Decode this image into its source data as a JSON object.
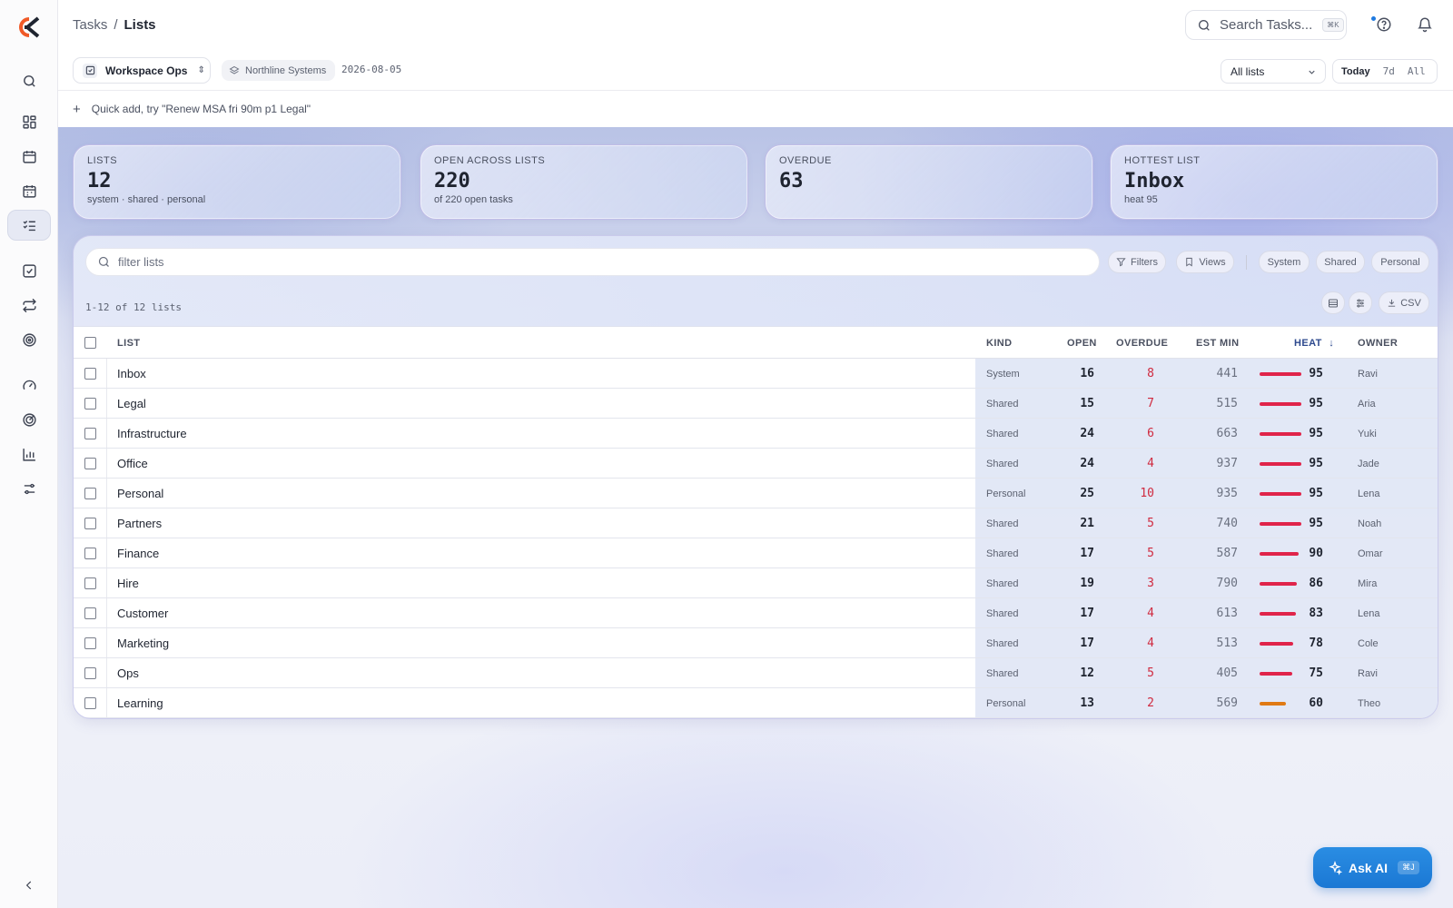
{
  "colors": {
    "accent": "#1b78d4",
    "logo_orange": "#f05a28",
    "logo_dark": "#1f2430",
    "overdue_red": "#d02a3f",
    "heat_high": "#e0244a",
    "heat_mid": "#e07a14"
  },
  "sidebar": {
    "logo": "brand-logo",
    "items": [
      {
        "icon": "search-icon"
      },
      {
        "icon": "dashboard-icon"
      },
      {
        "icon": "calendar-icon"
      },
      {
        "icon": "calendar-grid-icon"
      },
      {
        "icon": "list-checks-icon",
        "active": true
      },
      {
        "icon": "checkbox-icon"
      },
      {
        "icon": "repeat-icon"
      },
      {
        "icon": "target-icon"
      },
      {
        "icon": "gauge-icon"
      },
      {
        "icon": "radar-icon"
      },
      {
        "icon": "bar-chart-icon"
      },
      {
        "icon": "sliders-icon"
      }
    ],
    "collapse_icon": "chevron-left-icon"
  },
  "header": {
    "breadcrumb": {
      "parent": "Tasks",
      "separator": "/",
      "current": "Lists"
    },
    "search": {
      "placeholder": "Search Tasks...",
      "shortcut": "⌘K"
    },
    "help_icon": "help-circle-icon",
    "notifications_icon": "bell-icon"
  },
  "context": {
    "workspace": "Workspace Ops",
    "org": "Northline Systems",
    "date": "2026-08-05",
    "list_filter": "All lists",
    "ranges": [
      "Today",
      "7d",
      "All"
    ],
    "selected_range": "Today"
  },
  "quickadd": {
    "placeholder": "Quick add, try \"Renew MSA fri 90m p1 Legal\""
  },
  "stats": [
    {
      "label": "LISTS",
      "value": "12",
      "sub": "system · shared · personal"
    },
    {
      "label": "OPEN ACROSS LISTS",
      "value": "220",
      "sub": "of 220 open tasks"
    },
    {
      "label": "OVERDUE",
      "value": "63",
      "sub": ""
    },
    {
      "label": "HOTTEST LIST",
      "value": "Inbox",
      "sub": "heat 95"
    }
  ],
  "toolbar": {
    "filter_placeholder": "filter lists",
    "filters_label": "Filters",
    "views_label": "Views",
    "kind_pills": [
      "System",
      "Shared",
      "Personal"
    ],
    "count_text": "1-12 of 12 lists",
    "csv_label": "CSV"
  },
  "table": {
    "columns": {
      "list": "LIST",
      "kind": "KIND",
      "open": "OPEN",
      "overdue": "OVERDUE",
      "est": "EST MIN",
      "heat": "HEAT",
      "owner": "OWNER"
    },
    "sort_indicator": "↓",
    "rows": [
      {
        "name": "Inbox",
        "kind": "System",
        "open": "16",
        "overdue": "8",
        "est": "441",
        "heat": "95",
        "heat_value": 95,
        "owner": "Ravi"
      },
      {
        "name": "Legal",
        "kind": "Shared",
        "open": "15",
        "overdue": "7",
        "est": "515",
        "heat": "95",
        "heat_value": 95,
        "owner": "Aria"
      },
      {
        "name": "Infrastructure",
        "kind": "Shared",
        "open": "24",
        "overdue": "6",
        "est": "663",
        "heat": "95",
        "heat_value": 95,
        "owner": "Yuki"
      },
      {
        "name": "Office",
        "kind": "Shared",
        "open": "24",
        "overdue": "4",
        "est": "937",
        "heat": "95",
        "heat_value": 95,
        "owner": "Jade"
      },
      {
        "name": "Personal",
        "kind": "Personal",
        "open": "25",
        "overdue": "10",
        "est": "935",
        "heat": "95",
        "heat_value": 95,
        "owner": "Lena"
      },
      {
        "name": "Partners",
        "kind": "Shared",
        "open": "21",
        "overdue": "5",
        "est": "740",
        "heat": "95",
        "heat_value": 95,
        "owner": "Noah"
      },
      {
        "name": "Finance",
        "kind": "Shared",
        "open": "17",
        "overdue": "5",
        "est": "587",
        "heat": "90",
        "heat_value": 90,
        "owner": "Omar"
      },
      {
        "name": "Hire",
        "kind": "Shared",
        "open": "19",
        "overdue": "3",
        "est": "790",
        "heat": "86",
        "heat_value": 86,
        "owner": "Mira"
      },
      {
        "name": "Customer",
        "kind": "Shared",
        "open": "17",
        "overdue": "4",
        "est": "613",
        "heat": "83",
        "heat_value": 83,
        "owner": "Lena"
      },
      {
        "name": "Marketing",
        "kind": "Shared",
        "open": "17",
        "overdue": "4",
        "est": "513",
        "heat": "78",
        "heat_value": 78,
        "owner": "Cole"
      },
      {
        "name": "Ops",
        "kind": "Shared",
        "open": "12",
        "overdue": "5",
        "est": "405",
        "heat": "75",
        "heat_value": 75,
        "owner": "Ravi"
      },
      {
        "name": "Learning",
        "kind": "Personal",
        "open": "13",
        "overdue": "2",
        "est": "569",
        "heat": "60",
        "heat_value": 60,
        "owner": "Theo"
      }
    ]
  },
  "ask_ai": {
    "label": "Ask AI",
    "shortcut": "⌘J"
  }
}
